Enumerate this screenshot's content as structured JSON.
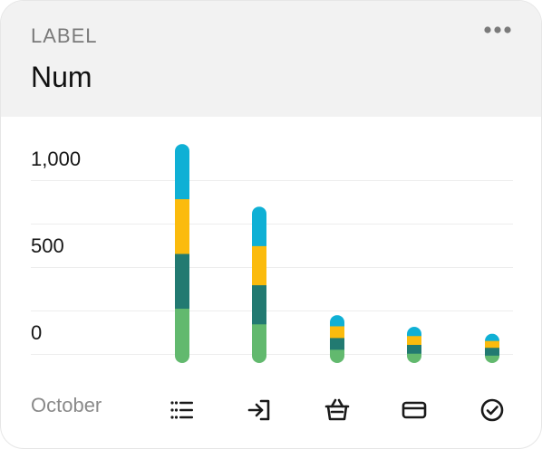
{
  "card": {
    "label": "LABEL",
    "num": "Num",
    "more_icon": "more-horizontal-icon"
  },
  "y_axis": [
    "1,000",
    "500",
    "0"
  ],
  "x_label": "October",
  "colors": {
    "segment_1": "#62b96e",
    "segment_2": "#227a71",
    "segment_3": "#fbbb0d",
    "segment_4": "#0fb0d5",
    "header_bg": "#f2f2f2"
  },
  "chart_data": {
    "type": "bar",
    "stacked": true,
    "categories": [
      "list",
      "sign-in",
      "basket",
      "credit-card",
      "check-circle"
    ],
    "ylim": [
      0,
      1000
    ],
    "series": [
      {
        "values": [
          280,
          200,
          70,
          50,
          40
        ]
      },
      {
        "values": [
          280,
          200,
          60,
          45,
          40
        ]
      },
      {
        "values": [
          280,
          200,
          60,
          45,
          35
        ]
      },
      {
        "values": [
          280,
          200,
          55,
          45,
          35
        ]
      }
    ]
  },
  "icons": [
    "list-icon",
    "sign-in-icon",
    "basket-icon",
    "credit-card-icon",
    "check-circle-icon"
  ]
}
